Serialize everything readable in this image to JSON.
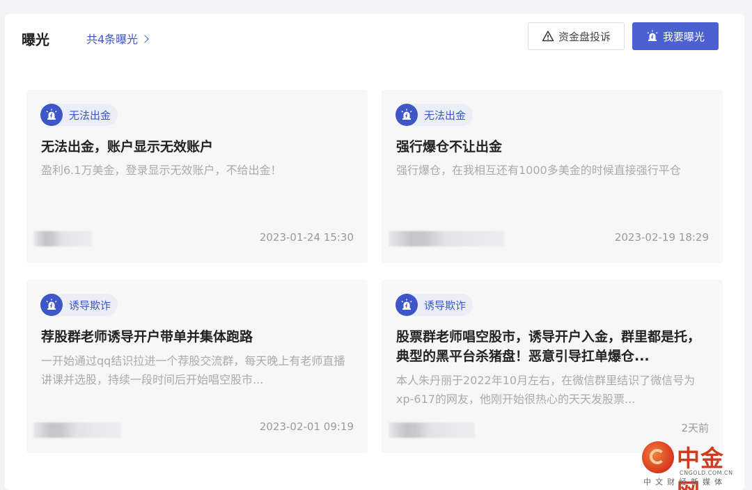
{
  "header": {
    "title": "曝光",
    "count_link": "共4条曝光",
    "complain_label": "资金盘投诉",
    "expose_label": "我要曝光"
  },
  "cards": [
    {
      "tag": "无法出金",
      "title": "无法出金，账户显示无效账户",
      "desc": "盈利6.1万美金，登录显示无效账户，不给出金！",
      "date": "2023-01-24 15:30"
    },
    {
      "tag": "无法出金",
      "title": "强行爆仓不让出金",
      "desc": "强行爆仓，在我相互还有1000多美金的时候直接强行平仓",
      "date": "2023-02-19 18:29"
    },
    {
      "tag": "诱导欺诈",
      "title": "荐股群老师诱导开户带单并集体跑路",
      "desc": "一开始通过qq结识拉进一个荐股交流群，每天晚上有老师直播讲课并选股，持续一段时间后开始唱空股市...",
      "date": "2023-02-01 09:19"
    },
    {
      "tag": "诱导欺诈",
      "title": "股票群老师唱空股市，诱导开户入金，群里都是托，典型的黑平台杀猪盘！恶意引导扛单爆仓...",
      "desc": "本人朱丹丽于2022年10月左右，在微信群里结识了微信号为xp-617的网友，他刚开始很热心的天天发股票...",
      "date": "2天前"
    }
  ],
  "watermark": {
    "name": "中金网",
    "url": "CNGOLD.COM.CN",
    "sub": "中文财经新媒体"
  },
  "colors": {
    "accent": "#4b61d1",
    "tag_text": "#3b56c8",
    "card_bg": "#f7f7f8"
  }
}
